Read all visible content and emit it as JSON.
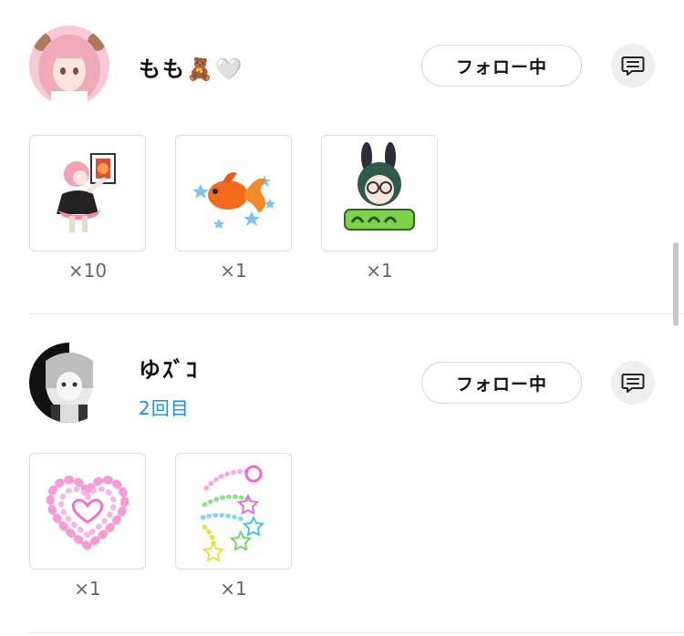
{
  "users": [
    {
      "name": "もも🧸🤍",
      "follow_label": "フォロー中",
      "gifts": [
        {
          "icon": "maid-sticker-icon",
          "count": "×10"
        },
        {
          "icon": "goldfish-sticker-icon",
          "count": "×1"
        },
        {
          "icon": "bunny-girl-sticker-icon",
          "count": "×1"
        }
      ]
    },
    {
      "name": "ゆｽﾞｺ",
      "visit": "2回目",
      "follow_label": "フォロー中",
      "gifts": [
        {
          "icon": "heart-sticker-icon",
          "count": "×1"
        },
        {
          "icon": "shooting-stars-sticker-icon",
          "count": "×1"
        }
      ]
    }
  ],
  "colors": {
    "accent": "#1d8cf0",
    "button_border": "#d7d7d7",
    "message_button_bg": "#efefef"
  }
}
